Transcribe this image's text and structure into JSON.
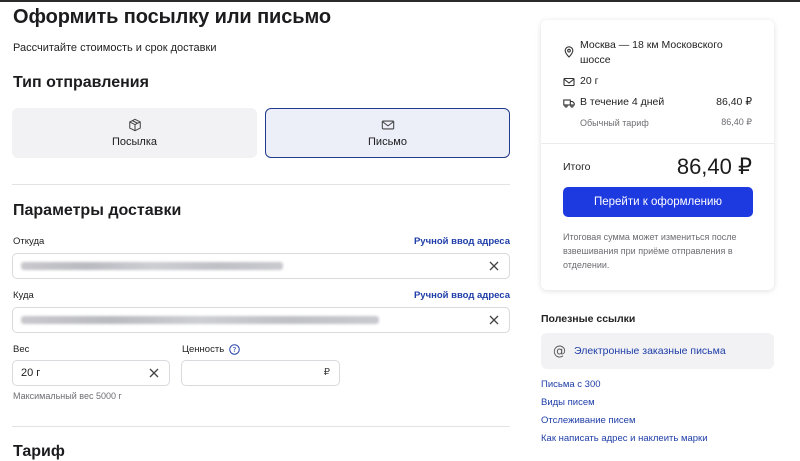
{
  "page": {
    "title": "Оформить посылку или письмо",
    "subtitle": "Рассчитайте стоимость и срок доставки"
  },
  "shipment_type": {
    "heading": "Тип отправления",
    "options": [
      {
        "label": "Посылка",
        "icon": "box-icon",
        "selected": false
      },
      {
        "label": "Письмо",
        "icon": "envelope-icon",
        "selected": true
      }
    ]
  },
  "delivery": {
    "heading": "Параметры доставки",
    "from_label": "Откуда",
    "to_label": "Куда",
    "manual_address_link": "Ручной ввод адреса",
    "weight_label": "Вес",
    "weight_value": "20 г",
    "weight_hint": "Максимальный вес 5000 г",
    "value_label": "Ценность",
    "value_currency": "₽"
  },
  "tariff": {
    "heading": "Тариф"
  },
  "summary": {
    "route": "Москва — 18 км Московского шоссе",
    "weight": "20 г",
    "delivery_time": "В течение 4 дней",
    "delivery_price": "86,40 ₽",
    "tariff_name": "Обычный тариф",
    "tariff_price": "86,40 ₽",
    "total_label": "Итого",
    "total_value": "86,40 ₽",
    "checkout_button": "Перейти к оформлению",
    "note": "Итоговая сумма может измениться после взвешивания при приёме отправления в отделении."
  },
  "useful_links": {
    "heading": "Полезные ссылки",
    "featured": "Электронные заказные письма",
    "items": [
      "Письма с 300",
      "Виды писем",
      "Отслеживание писем",
      "Как написать адрес и наклеить марки"
    ]
  },
  "colors": {
    "accent": "#1d39e0",
    "link": "#1f3ea8",
    "selected_border": "#243a8c"
  }
}
